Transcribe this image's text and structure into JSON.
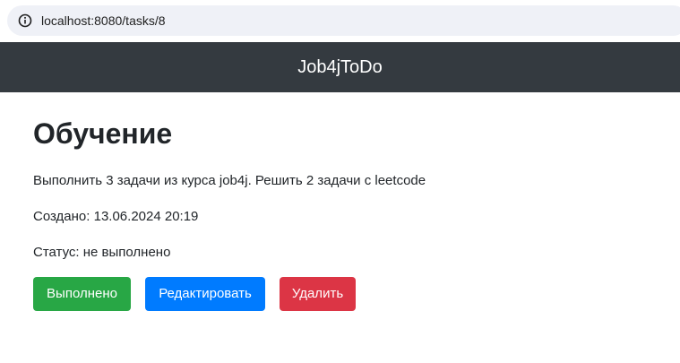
{
  "browser": {
    "url": "localhost:8080/tasks/8",
    "site_info_icon": "info-circle-icon"
  },
  "navbar": {
    "brand": "Job4jToDo",
    "background": "#343a40"
  },
  "task": {
    "title": "Обучение",
    "description": "Выполнить 3 задачи из курса job4j. Решить 2 задачи с leetcode",
    "created": "Создано: 13.06.2024 20:19",
    "status": "Статус: не выполнено"
  },
  "actions": {
    "done_label": "Выполнено",
    "edit_label": "Редактировать",
    "delete_label": "Удалить",
    "done_color": "#28a745",
    "edit_color": "#007bff",
    "delete_color": "#dc3545"
  }
}
